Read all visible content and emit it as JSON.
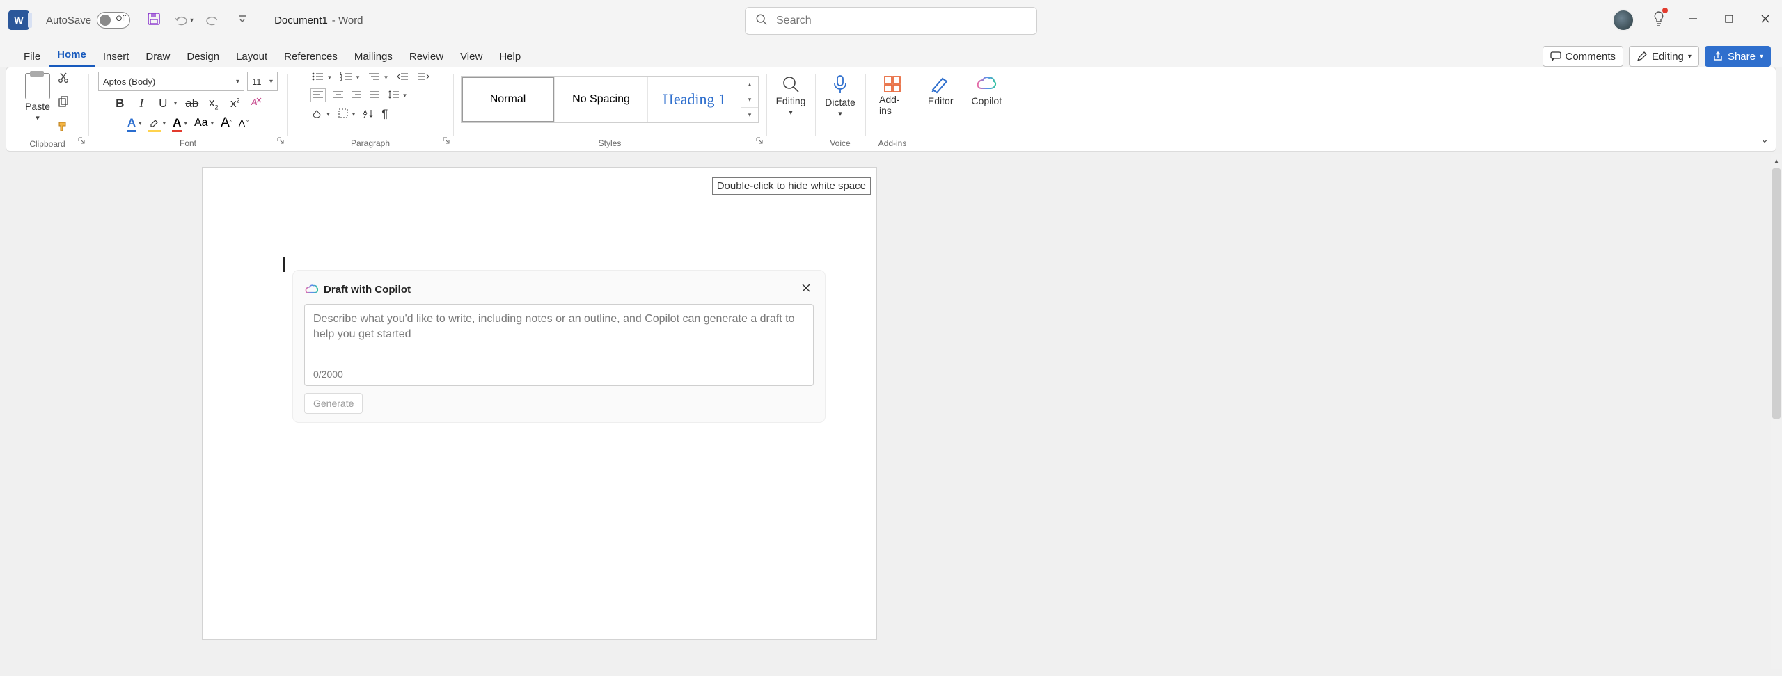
{
  "titlebar": {
    "app_letter": "W",
    "autosave_label": "AutoSave",
    "autosave_state": "Off",
    "doc_name": "Document1",
    "doc_suffix": "- Word",
    "search_placeholder": "Search"
  },
  "menu": {
    "tabs": [
      "File",
      "Home",
      "Insert",
      "Draw",
      "Design",
      "Layout",
      "References",
      "Mailings",
      "Review",
      "View",
      "Help"
    ],
    "active_tab": "Home",
    "comments": "Comments",
    "editing": "Editing",
    "share": "Share"
  },
  "ribbon": {
    "clipboard": {
      "paste": "Paste",
      "group": "Clipboard"
    },
    "font": {
      "family": "Aptos (Body)",
      "size": "11",
      "group": "Font",
      "bold": "B",
      "italic": "I",
      "underline": "U",
      "strike": "ab",
      "sub": "x",
      "sub_small": "2",
      "sup": "x",
      "sup_small": "2",
      "case": "Aa",
      "grow": "A",
      "shrink": "A"
    },
    "paragraph": {
      "group": "Paragraph"
    },
    "styles": {
      "items": [
        "Normal",
        "No Spacing",
        "Heading 1"
      ],
      "group": "Styles"
    },
    "editing_btn": "Editing",
    "dictate": "Dictate",
    "voice_group": "Voice",
    "addins": "Add-ins",
    "addins_group": "Add-ins",
    "editor": "Editor",
    "copilot": "Copilot"
  },
  "document": {
    "whitespace_tip": "Double-click to hide white space"
  },
  "copilot": {
    "title": "Draft with Copilot",
    "placeholder": "Describe what you'd like to write, including notes or an outline, and Copilot can generate a draft to help you get started",
    "counter": "0/2000",
    "generate": "Generate"
  }
}
